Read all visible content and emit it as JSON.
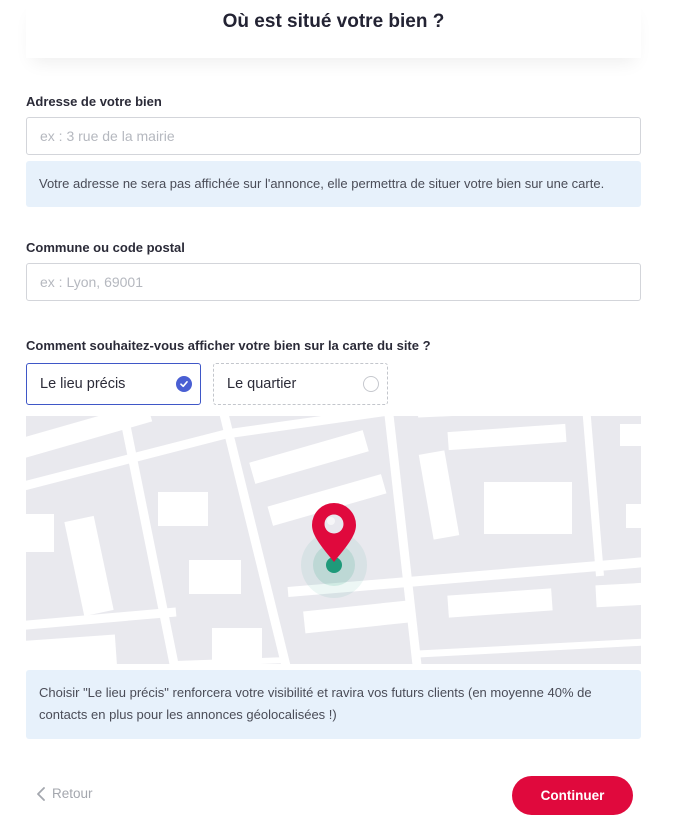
{
  "header": {
    "title": "Où est situé votre bien ?"
  },
  "address": {
    "label": "Adresse de votre bien",
    "placeholder": "ex : 3 rue de la mairie",
    "value": "",
    "info": "Votre adresse ne sera pas affichée sur l'annonce, elle permettra de situer votre bien sur une carte."
  },
  "commune": {
    "label": "Commune ou code postal",
    "placeholder": "ex : Lyon, 69001",
    "value": ""
  },
  "display": {
    "question": "Comment souhaitez-vous afficher votre bien sur la carte du site ?",
    "options": [
      {
        "label": "Le lieu précis",
        "selected": true
      },
      {
        "label": "Le quartier",
        "selected": false
      }
    ],
    "info": "Choisir \"Le lieu précis\" renforcera votre visibilité et ravira vos futurs clients (en moyenne 40% de contacts en plus pour les annonces géolocalisées !)"
  },
  "footer": {
    "back_label": "Retour",
    "continue_label": "Continuer"
  },
  "colors": {
    "accent": "#e0093d",
    "selection": "#3f57c7",
    "info_bg": "#e7f1fb",
    "pin": "#e0093d",
    "pin_dot": "#1f9a7a"
  }
}
